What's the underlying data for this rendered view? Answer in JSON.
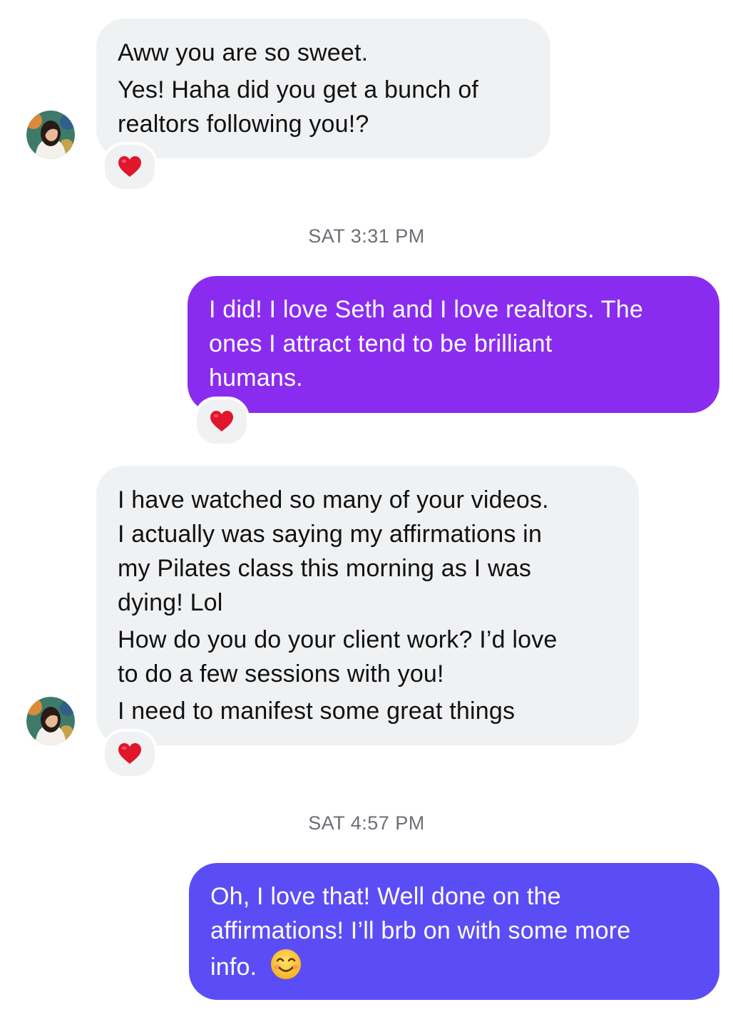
{
  "conversation": {
    "colors": {
      "incoming_bubble": "#f0f1f3",
      "outgoing_bubble_1": "#8a2cf0",
      "outgoing_bubble_2": "#5b4df5",
      "reaction_heart": "#e0162b",
      "timestamp_text": "#6b6f76"
    },
    "messages": [
      {
        "sender": "contact",
        "lines": [
          "Aww you are so sweet.",
          "Yes! Haha did you get a bunch of",
          "realtors following you!?"
        ],
        "reaction": "heart-icon"
      },
      {
        "type": "timestamp",
        "text": "SAT 3:31 PM"
      },
      {
        "sender": "me",
        "lines": [
          "I did! I love Seth and I love realtors. The",
          "ones I attract tend to be brilliant",
          "humans."
        ],
        "reaction": "heart-icon"
      },
      {
        "sender": "contact",
        "lines": [
          "I have watched so many of your videos.",
          "I actually was saying my affirmations in",
          "my Pilates class this morning as I was",
          "dying! Lol",
          "How do you do your client work? I’d love",
          "to do a few sessions with you!",
          "I need to manifest some great things"
        ],
        "reaction": "heart-icon"
      },
      {
        "type": "timestamp",
        "text": "SAT 4:57 PM"
      },
      {
        "sender": "me",
        "lines": [
          "Oh, I love that! Well done on the",
          "affirmations! I’ll brb on with some more",
          "info."
        ],
        "emoji": "smiling-face-icon"
      }
    ]
  }
}
